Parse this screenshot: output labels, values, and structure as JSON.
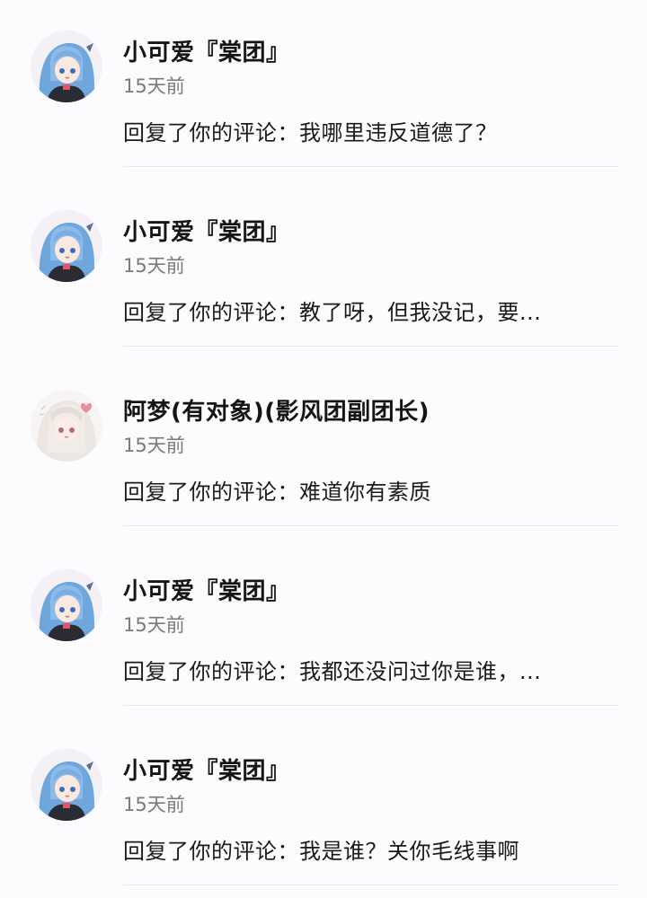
{
  "notifications": [
    {
      "avatar_icon": "blue-hair-anime-avatar",
      "name": "小可爱『棠团』",
      "time": "15天前",
      "content": "回复了你的评论：我哪里违反道德了？"
    },
    {
      "avatar_icon": "blue-hair-anime-avatar",
      "name": "小可爱『棠团』",
      "time": "15天前",
      "content": "回复了你的评论：教了呀，但我没记，要..."
    },
    {
      "avatar_icon": "white-hair-anime-avatar",
      "name": "阿梦(有对象)(影风团副团长)",
      "time": "15天前",
      "content": "回复了你的评论：难道你有素质"
    },
    {
      "avatar_icon": "blue-hair-anime-avatar",
      "name": "小可爱『棠团』",
      "time": "15天前",
      "content": "回复了你的评论：我都还没问过你是谁，..."
    },
    {
      "avatar_icon": "blue-hair-anime-avatar",
      "name": "小可爱『棠团』",
      "time": "15天前",
      "content": "回复了你的评论：我是谁？关你毛线事啊"
    }
  ]
}
